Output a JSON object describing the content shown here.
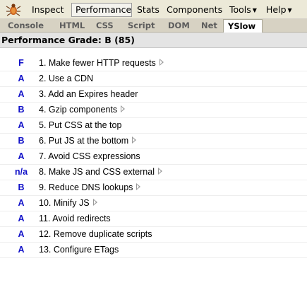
{
  "menubar": {
    "items": [
      {
        "label": "Inspect",
        "active": false,
        "dropdown": false
      },
      {
        "label": "Performance",
        "active": true,
        "dropdown": false
      },
      {
        "label": "Stats",
        "active": false,
        "dropdown": false
      },
      {
        "label": "Components",
        "active": false,
        "dropdown": false
      },
      {
        "label": "Tools",
        "active": false,
        "dropdown": true
      },
      {
        "label": "Help",
        "active": false,
        "dropdown": true
      }
    ],
    "logo_icon": "firebug-bug-icon"
  },
  "tabs": [
    {
      "label": "Console",
      "active": false
    },
    {
      "label": "HTML",
      "active": false
    },
    {
      "label": "CSS",
      "active": false
    },
    {
      "label": "Script",
      "active": false
    },
    {
      "label": "DOM",
      "active": false
    },
    {
      "label": "Net",
      "active": false
    },
    {
      "label": "YSlow",
      "active": true
    }
  ],
  "grade_header": "Performance Grade: B (85)",
  "rules": [
    {
      "grade": "F",
      "label": "1. Make fewer HTTP requests",
      "expandable": true
    },
    {
      "grade": "A",
      "label": "2. Use a CDN",
      "expandable": false
    },
    {
      "grade": "A",
      "label": "3. Add an Expires header",
      "expandable": false
    },
    {
      "grade": "B",
      "label": "4. Gzip components",
      "expandable": true
    },
    {
      "grade": "A",
      "label": "5. Put CSS at the top",
      "expandable": false
    },
    {
      "grade": "B",
      "label": "6. Put JS at the bottom",
      "expandable": true
    },
    {
      "grade": "A",
      "label": "7. Avoid CSS expressions",
      "expandable": false
    },
    {
      "grade": "n/a",
      "label": "8. Make JS and CSS external",
      "expandable": true
    },
    {
      "grade": "B",
      "label": "9. Reduce DNS lookups",
      "expandable": true
    },
    {
      "grade": "A",
      "label": "10. Minify JS",
      "expandable": true
    },
    {
      "grade": "A",
      "label": "11. Avoid redirects",
      "expandable": false
    },
    {
      "grade": "A",
      "label": "12. Remove duplicate scripts",
      "expandable": false
    },
    {
      "grade": "A",
      "label": "13. Configure ETags",
      "expandable": false
    }
  ],
  "colors": {
    "grade_letter": "#1010c8",
    "menubar_bg": "#ece9d8",
    "tabbar_bg": "#d7d2c3",
    "header_bg": "#e4e4e4"
  }
}
